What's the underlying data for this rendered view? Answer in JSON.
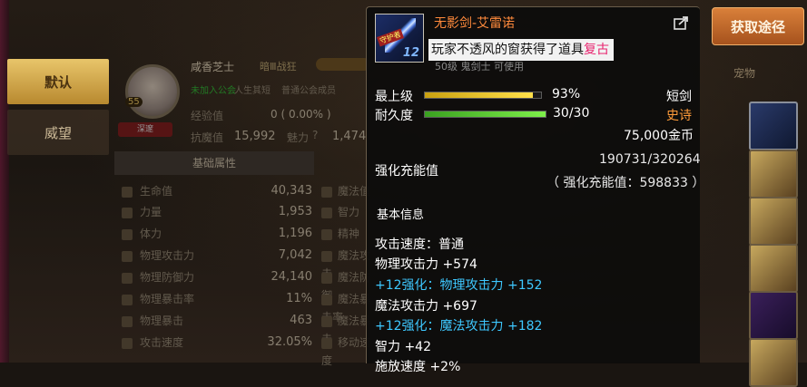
{
  "left_tabs": [
    {
      "label": "默认",
      "active": true
    },
    {
      "label": "威望",
      "active": false
    }
  ],
  "character": {
    "name": "咸香芝士",
    "title": "暗Ⅲ战狂",
    "level_badge": "55",
    "guild_status": "未加入公会",
    "guild_a": "人生其短",
    "guild_b": "普通公会成员",
    "exp_label": "经验值",
    "exp_value": "0 ( 0.00% )",
    "red_button": "深邃",
    "kill_label": "抗魔值",
    "kill_value": "15,992",
    "charm_label": "魅力",
    "charm_value": "1,474",
    "section_title": "基础属性",
    "stats": [
      {
        "label": "生命值",
        "value": "40,343"
      },
      {
        "label": "力量",
        "value": "1,953"
      },
      {
        "label": "体力",
        "value": "1,196"
      },
      {
        "label": "物理攻击力",
        "value": "7,042"
      },
      {
        "label": "物理防御力",
        "value": "24,140"
      },
      {
        "label": "物理暴击率",
        "value": "11%"
      },
      {
        "label": "物理暴击",
        "value": "463"
      },
      {
        "label": "攻击速度",
        "value": "32.05%"
      }
    ],
    "stats_right": [
      "魔法值",
      "智力",
      "精神",
      "魔法攻击",
      "魔法防御",
      "魔法暴击率",
      "魔法暴击",
      "移动速度"
    ]
  },
  "right": {
    "acquire_button": "获取途径",
    "pet_label": "宠物"
  },
  "tooltip": {
    "item_name": "无影剑-艾雷诺",
    "enhance_badge": "12",
    "item_badge": "守护者",
    "notice_text": "玩家不透风的窗获得了道具",
    "notice_highlight": "复古",
    "sub_info": "50级 鬼剑士 可使用",
    "top_level_label": "最上级",
    "top_level_pct": "93%",
    "top_level_fill": 0.93,
    "type": "短剑",
    "durability_label": "耐久度",
    "durability_value": "30/30",
    "durability_fill": 1.0,
    "rarity": "史诗",
    "price": "75,000金币",
    "charge_label": "强化充能值",
    "charge_value": "190731/320264",
    "charge_detail": "（ 强化充能值：598833 ）",
    "basic_info": "基本信息",
    "attrs": [
      {
        "text": "攻击速度：普通",
        "color": "white"
      },
      {
        "text": "物理攻击力 +574",
        "color": "white"
      },
      {
        "text": "+12强化：物理攻击力 +152",
        "color": "cyan"
      },
      {
        "text": "魔法攻击力 +697",
        "color": "white"
      },
      {
        "text": "+12强化：魔法攻击力 +182",
        "color": "cyan"
      },
      {
        "text": "智力 +42",
        "color": "white"
      },
      {
        "text": "施放速度 +2%",
        "color": "white"
      }
    ]
  }
}
